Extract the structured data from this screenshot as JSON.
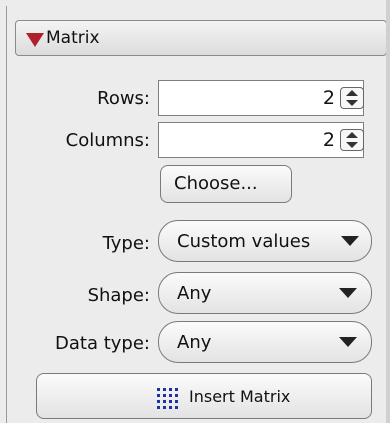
{
  "panel": {
    "title": "Matrix",
    "rows_label": "Rows:",
    "rows_value": "2",
    "columns_label": "Columns:",
    "columns_value": "2",
    "choose_button": "Choose...",
    "type_label": "Type:",
    "type_value": "Custom values",
    "shape_label": "Shape:",
    "shape_value": "Any",
    "datatype_label": "Data type:",
    "datatype_value": "Any",
    "insert_button": "Insert Matrix"
  },
  "colors": {
    "accent": "#b0202a",
    "icon_blue": "#1e2fa8"
  },
  "icons": [
    "collapse-triangle-icon",
    "spinner-icon",
    "dropdown-arrow-icon",
    "matrix-grid-icon"
  ]
}
